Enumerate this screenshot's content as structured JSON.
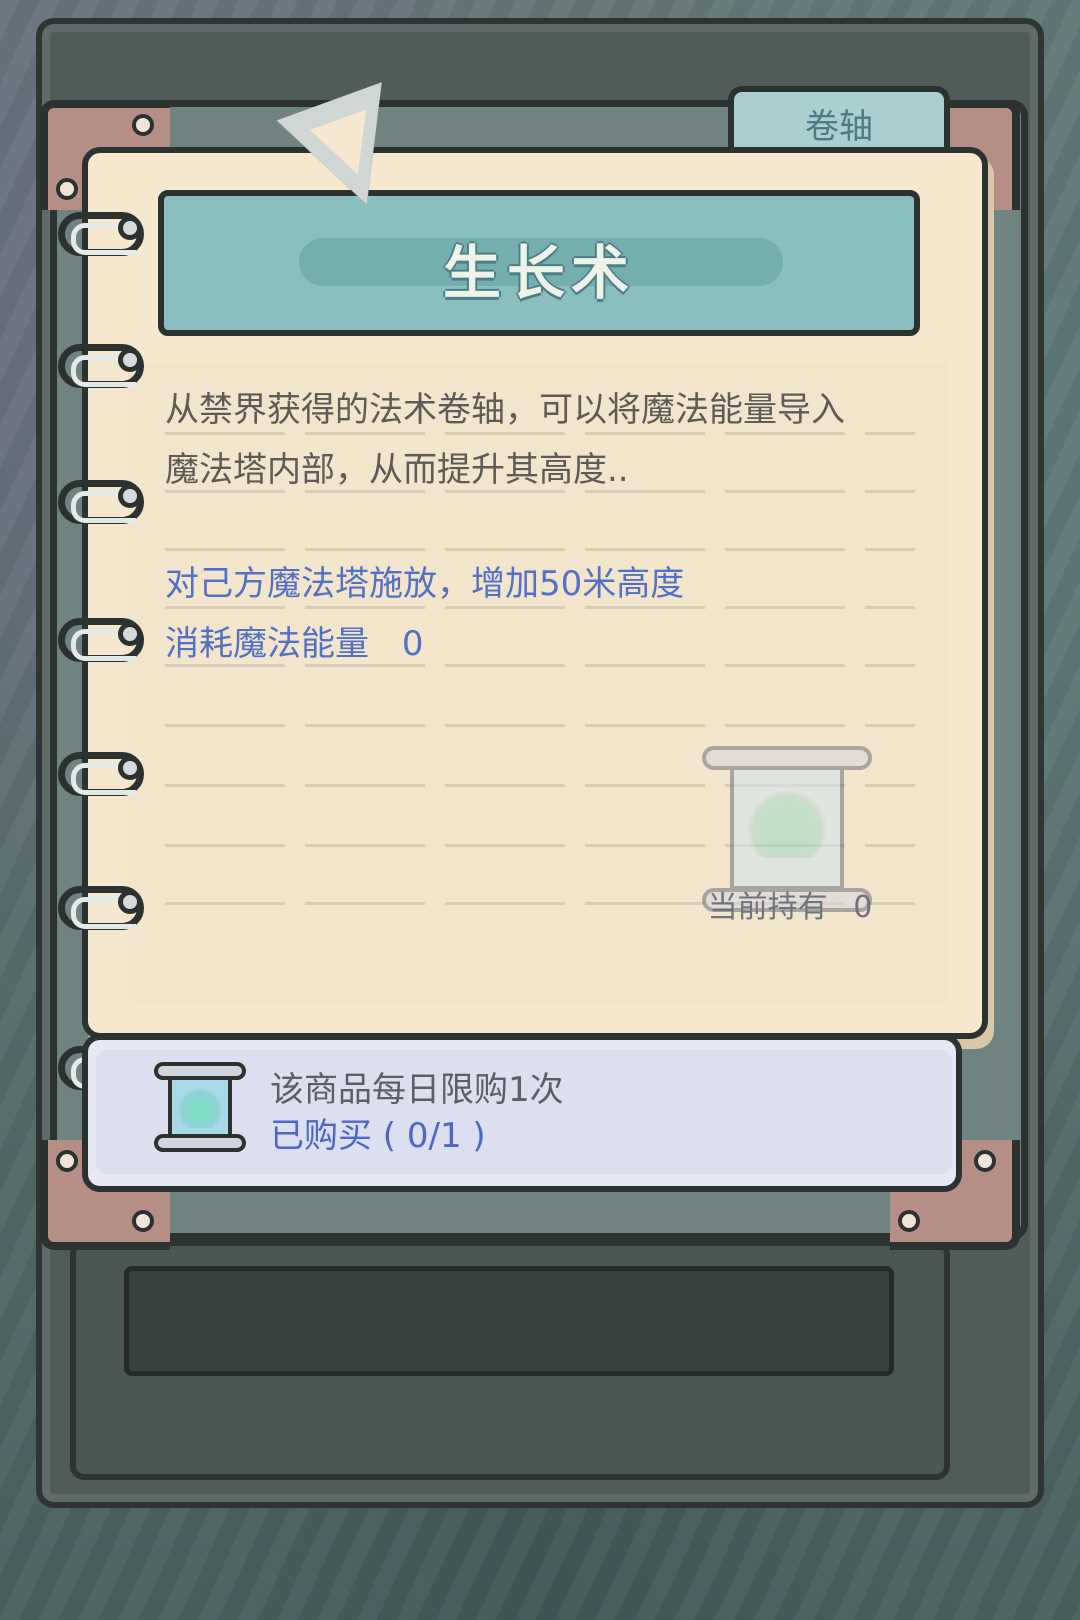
{
  "tab": {
    "label": "卷轴"
  },
  "spell": {
    "title": "生长术",
    "description_lines": [
      "从禁界获得的法术卷轴，可以将魔法能量导入",
      "魔法塔内部，从而提升其高度.."
    ],
    "effect": "对己方魔法塔施放，增加50米高度",
    "cost_label": "消耗魔法能量",
    "cost_value": "0"
  },
  "held": {
    "label": "当前持有",
    "count": "0",
    "icon": "scroll-icon"
  },
  "purchase": {
    "limit_text": "该商品每日限购1次",
    "bought_text": "已购买 ( 0/1 )",
    "icon": "scroll-icon"
  },
  "colors": {
    "page": "#f5e8cf",
    "banner": "#8bbfbf",
    "effect_text": "#5370c8",
    "outline": "#2c3230"
  }
}
